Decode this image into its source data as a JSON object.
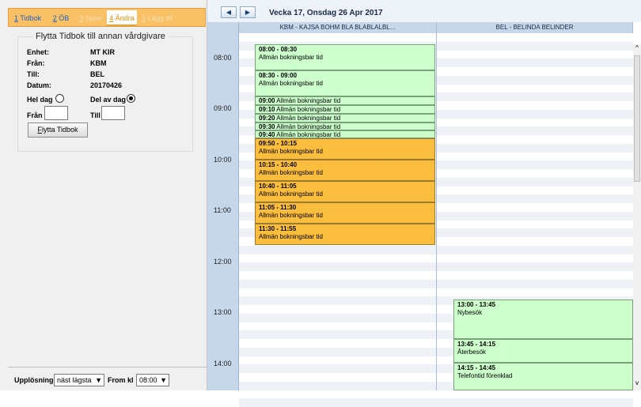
{
  "tabs": [
    {
      "num": "1",
      "label": "Tidbok"
    },
    {
      "num": "2",
      "label": "ÖB"
    },
    {
      "num": "3",
      "label": "Sparr"
    },
    {
      "num": "4",
      "label": "Ändra"
    },
    {
      "num": "5",
      "label": "Lägg till"
    }
  ],
  "panel": {
    "title": "Flytta Tidbok till annan vårdgivare",
    "rows": [
      {
        "label": "Enhet:",
        "value": "MT KIR"
      },
      {
        "label": "Från:",
        "value": "KBM"
      },
      {
        "label": "Till:",
        "value": "BEL"
      },
      {
        "label": "Datum:",
        "value": "20170426"
      }
    ],
    "hel_dag": "Hel dag",
    "del_av_dag": "Del av dag",
    "fran_label": "Från",
    "till_label": "Till",
    "fran_value": "",
    "till_value": "",
    "button_key": "F",
    "button_rest": "lytta Tidbok"
  },
  "bottom": {
    "resolution_label": "Upplösning",
    "resolution_value": "näst lägsta",
    "from_label": "From kl",
    "from_value": "08:00"
  },
  "calendar": {
    "prev_glyph": "◀",
    "next_glyph": "▶",
    "title": "Vecka 17, Onsdag 26 Apr 2017",
    "col1": "KBM - KAJSA BOHM BLA BLABLALBL...",
    "col2": "BEL - BELINDA BELINDER",
    "times": [
      "08:00",
      "09:00",
      "10:00",
      "11:00",
      "12:00",
      "13:00",
      "14:00"
    ],
    "events_col1": [
      {
        "time": "08:00 - 08:30",
        "text": "Allmän bokningsbar tid",
        "kind": "green"
      },
      {
        "time": "08:30 - 09:00",
        "text": "Allmän bokningsbar tid",
        "kind": "green"
      },
      {
        "time": "09:00",
        "text": "Allmän bokningsbar tid",
        "kind": "green",
        "inline": true
      },
      {
        "time": "09:10",
        "text": "Allmän bokningsbar tid",
        "kind": "green",
        "inline": true
      },
      {
        "time": "09:20",
        "text": "Allmän bokningsbar tid",
        "kind": "green",
        "inline": true
      },
      {
        "time": "09:30",
        "text": "Allmän bokningsbar tid",
        "kind": "green",
        "inline": true
      },
      {
        "time": "09:40",
        "text": "Allmän bokningsbar tid",
        "kind": "green",
        "inline": true
      },
      {
        "time": "09:50 - 10:15",
        "text": "Allmän bokningsbar tid",
        "kind": "orange"
      },
      {
        "time": "10:15 - 10:40",
        "text": "Allmän bokningsbar tid",
        "kind": "orange"
      },
      {
        "time": "10:40 - 11:05",
        "text": "Allmän bokningsbar tid",
        "kind": "orange"
      },
      {
        "time": "11:05 - 11:30",
        "text": "Allmän bokningsbar tid",
        "kind": "orange"
      },
      {
        "time": "11:30 - 11:55",
        "text": "Allmän bokningsbar tid",
        "kind": "orange"
      }
    ],
    "events_col2": [
      {
        "time": "13:00 - 13:45",
        "text": "Nybesök",
        "kind": "green"
      },
      {
        "time": "13:45 - 14:15",
        "text": "Återbesök",
        "kind": "green"
      },
      {
        "time": "14:15 - 14:45",
        "text": "Telefontid förenklad",
        "kind": "green"
      }
    ]
  }
}
